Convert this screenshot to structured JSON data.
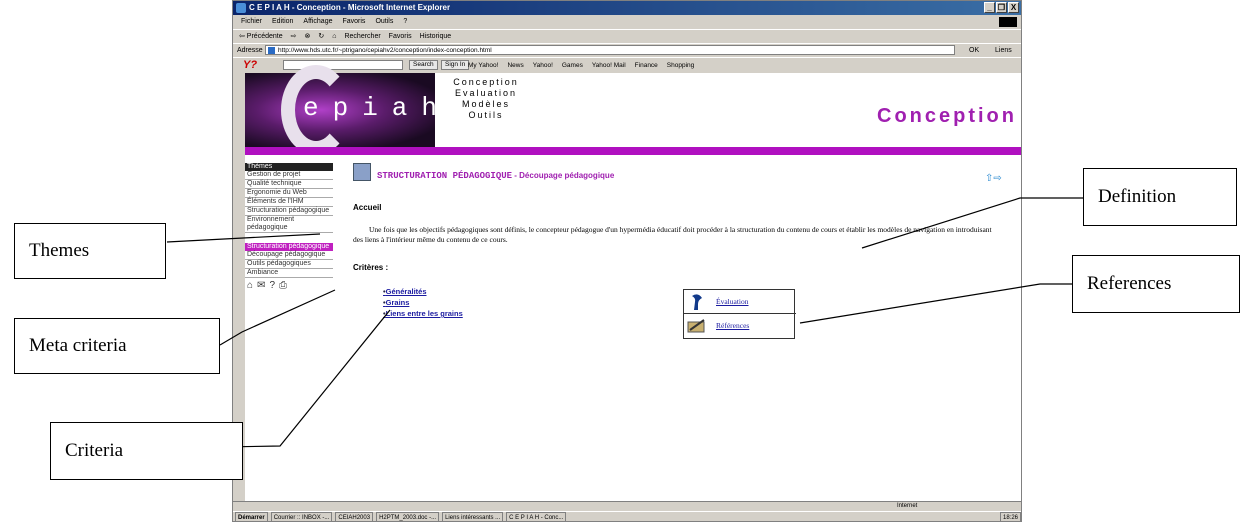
{
  "browser": {
    "title": "C E P I A H - Conception - Microsoft Internet Explorer",
    "window_buttons": [
      "_",
      "❐",
      "X"
    ],
    "menu": [
      "Fichier",
      "Edition",
      "Affichage",
      "Favoris",
      "Outils",
      "?"
    ],
    "toolbar": [
      "⇦ Précédente",
      "⇨",
      "⊗",
      "↻",
      "⌂",
      "Rechercher",
      "Favoris",
      "Historique"
    ],
    "address_label": "Adresse",
    "address_url": "http://www.hds.utc.fr/~ptrigano/cepiahv2/conception/index-conception.html",
    "go_label": "OK",
    "links_label": "Liens",
    "yahoo": {
      "logo": "Y?",
      "search_btn": "Search",
      "signin_btn": "Sign In",
      "links": [
        "My Yahoo!",
        "News",
        "Yahoo!",
        "Games",
        "Yahoo! Mail",
        "Finance",
        "Shopping"
      ]
    },
    "status_zone": "Internet"
  },
  "banner": {
    "logo": "epiah",
    "subtitle_lines": [
      "Conception",
      "Evaluation",
      "Modèles",
      "Outils"
    ],
    "section": "Conception"
  },
  "sidebar": {
    "header": "Thèmes",
    "themes": [
      "Gestion de projet",
      "Qualité technique",
      "Ergonomie du Web",
      "Éléments de l'IHM",
      "Structuration pédagogique",
      "Environnement pédagogique"
    ],
    "meta_selected": "Structuration pédagogique",
    "meta_items": [
      "Découpage pédagogique",
      "Outils pédagogiques",
      "Ambiance"
    ]
  },
  "main": {
    "title": "STRUCTURATION PÉDAGOGIQUE",
    "title_sub": " - Découpage pédagogique",
    "arrows": "⇧⇨",
    "accueil": "Accueil",
    "paragraph": "Une fois que les objectifs pédagogiques sont définis, le concepteur pédagogue d'un hypermédia éducatif doit procéder à la structuration du contenu de cours et établir les modèles de navigation en introduisant des liens à l'intérieur même du contenu de ce cours.",
    "criteres_label": "Critères :",
    "criteria": [
      "Généralités",
      "Grains",
      "Liens entre les grains"
    ],
    "ref_links": [
      "Évaluation",
      "Références"
    ]
  },
  "taskbar": {
    "start": "Démarrer",
    "items": [
      "Courrier :: INBOX -...",
      "CEIAH2003",
      "H2PTM_2003.doc -...",
      "Liens intéressants ...",
      "C E P I A H - Conc..."
    ],
    "time": "18:26"
  },
  "callouts": {
    "themes": "Themes",
    "meta": "Meta criteria",
    "criteria": "Criteria",
    "definition": "Definition",
    "references": "References"
  }
}
